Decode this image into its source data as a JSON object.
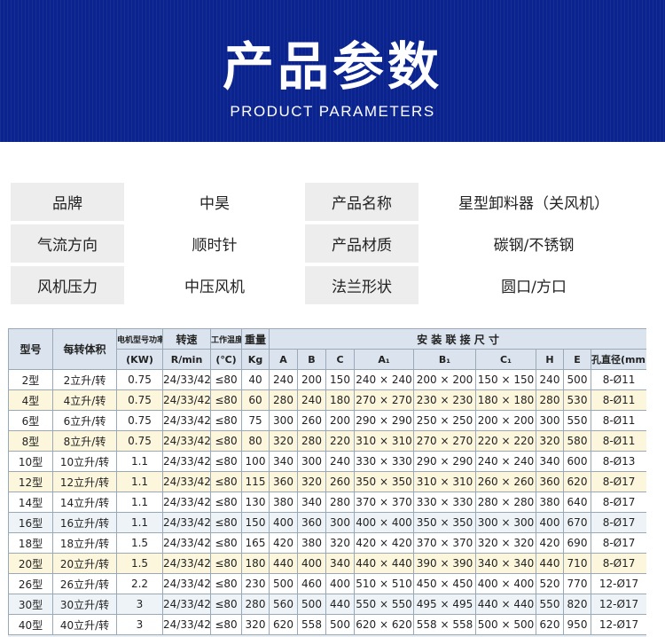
{
  "banner": {
    "title": "产品参数",
    "subtitle": "PRODUCT PARAMETERS"
  },
  "info": [
    {
      "label1": "品牌",
      "value1": "中昊",
      "label2": "产品名称",
      "value2": "星型卸料器（关风机）"
    },
    {
      "label1": "气流方向",
      "value1": "顺时针",
      "label2": "产品材质",
      "value2": "碳钢/不锈钢"
    },
    {
      "label1": "风机压力",
      "value1": "中压风机",
      "label2": "法兰形状",
      "value2": "圆口/方口"
    }
  ],
  "spec": {
    "header": {
      "model": "型号",
      "volume": "每转体积",
      "power": "电机型号功率",
      "speed": "转速",
      "temp": "工作温度",
      "weight": "重量",
      "dims": "安 装 联 接 尺 寸"
    },
    "units": [
      "(KW)",
      "R/min",
      "(℃)",
      "Kg",
      "A",
      "B",
      "C",
      "A₁",
      "B₁",
      "C₁",
      "H",
      "E",
      "孔直径(mm)"
    ],
    "rows": [
      [
        "2型",
        "2立升/转",
        "0.75",
        "24/33/42",
        "≤80",
        "40",
        "240",
        "200",
        "150",
        "240 × 240",
        "200 × 200",
        "150 × 150",
        "240",
        "500",
        "8-Ø11"
      ],
      [
        "4型",
        "4立升/转",
        "0.75",
        "24/33/42",
        "≤80",
        "60",
        "280",
        "240",
        "180",
        "270 × 270",
        "230 × 230",
        "180 × 180",
        "280",
        "530",
        "8-Ø11"
      ],
      [
        "6型",
        "6立升/转",
        "0.75",
        "24/33/42",
        "≤80",
        "75",
        "300",
        "260",
        "200",
        "290 × 290",
        "250 × 250",
        "200 × 200",
        "300",
        "550",
        "8-Ø11"
      ],
      [
        "8型",
        "8立升/转",
        "0.75",
        "24/33/42",
        "≤80",
        "80",
        "320",
        "280",
        "220",
        "310 × 310",
        "270 × 270",
        "220 × 220",
        "320",
        "580",
        "8-Ø11"
      ],
      [
        "10型",
        "10立升/转",
        "1.1",
        "24/33/42",
        "≤80",
        "100",
        "340",
        "300",
        "240",
        "330 × 330",
        "290 × 290",
        "240 × 240",
        "340",
        "600",
        "8-Ø13"
      ],
      [
        "12型",
        "12立升/转",
        "1.1",
        "24/33/42",
        "≤80",
        "115",
        "360",
        "320",
        "260",
        "350 × 350",
        "310 × 310",
        "260 × 260",
        "360",
        "620",
        "8-Ø17"
      ],
      [
        "14型",
        "14立升/转",
        "1.1",
        "24/33/42",
        "≤80",
        "130",
        "380",
        "340",
        "280",
        "370 × 370",
        "330 × 330",
        "280 × 280",
        "380",
        "640",
        "8-Ø17"
      ],
      [
        "16型",
        "16立升/转",
        "1.1",
        "24/33/42",
        "≤80",
        "150",
        "400",
        "360",
        "300",
        "400 × 400",
        "350 × 350",
        "300 × 300",
        "400",
        "670",
        "8-Ø17"
      ],
      [
        "18型",
        "18立升/转",
        "1.5",
        "24/33/42",
        "≤80",
        "165",
        "420",
        "380",
        "320",
        "420 × 420",
        "370 × 370",
        "320 × 320",
        "420",
        "690",
        "8-Ø17"
      ],
      [
        "20型",
        "20立升/转",
        "1.5",
        "24/33/42",
        "≤80",
        "180",
        "440",
        "400",
        "340",
        "440 × 440",
        "390 × 390",
        "340 × 340",
        "440",
        "710",
        "8-Ø17"
      ],
      [
        "26型",
        "26立升/转",
        "2.2",
        "24/33/42",
        "≤80",
        "230",
        "500",
        "460",
        "400",
        "510 × 510",
        "450 × 450",
        "400 × 400",
        "520",
        "770",
        "12-Ø17"
      ],
      [
        "30型",
        "30立升/转",
        "3",
        "24/33/42",
        "≤80",
        "280",
        "560",
        "500",
        "440",
        "550 × 550",
        "495 × 495",
        "440 × 440",
        "550",
        "820",
        "12-Ø17"
      ],
      [
        "40型",
        "40立升/转",
        "3",
        "24/33/42",
        "≤80",
        "320",
        "620",
        "558",
        "500",
        "620 × 620",
        "558 × 558",
        "500 × 500",
        "620",
        "950",
        "12-Ø17"
      ]
    ]
  }
}
